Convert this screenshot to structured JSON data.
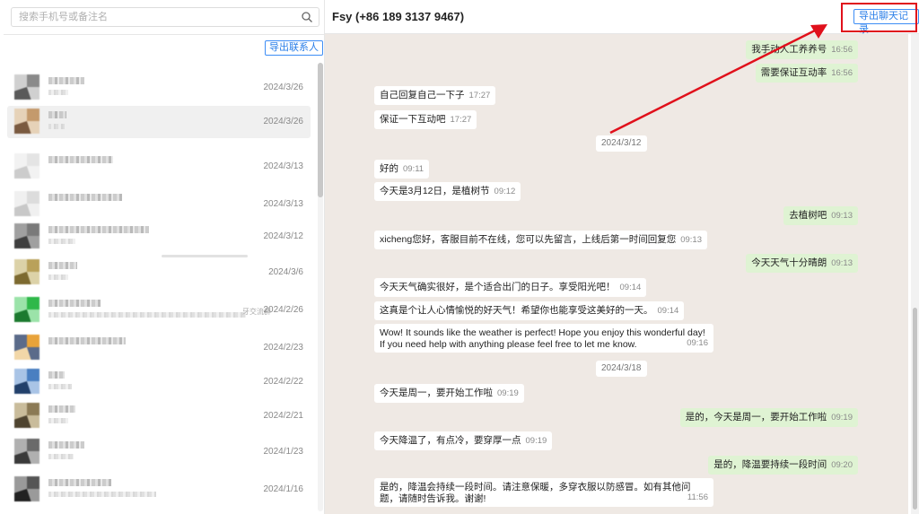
{
  "search": {
    "placeholder": "搜索手机号或备注名"
  },
  "left": {
    "export_contacts_label": "导出联系人"
  },
  "contacts": [
    {
      "date": "2024/3/26"
    },
    {
      "date": "2024/3/26"
    },
    {
      "date": "2024/3/13"
    },
    {
      "date": "2024/3/13"
    },
    {
      "date": "2024/3/12"
    },
    {
      "date": "2024/3/6"
    },
    {
      "date": "2024/2/26",
      "trail": "牙交流群"
    },
    {
      "date": "2024/2/23"
    },
    {
      "date": "2024/2/22"
    },
    {
      "date": "2024/2/21"
    },
    {
      "date": "2024/1/23"
    },
    {
      "date": "2024/1/16"
    }
  ],
  "header": {
    "title": "Fsy (+86 189 3137 9467)",
    "export_chat_label": "导出聊天记录"
  },
  "messages": [
    {
      "dir": "out",
      "text": "我手动人工养养号",
      "time": "16:56"
    },
    {
      "dir": "out",
      "text": "需要保证互动率",
      "time": "16:56"
    },
    {
      "dir": "in",
      "text": "自己回复自己一下子",
      "time": "17:27"
    },
    {
      "dir": "in",
      "text": "保证一下互动吧",
      "time": "17:27"
    },
    {
      "dir": "date",
      "text": "2024/3/12"
    },
    {
      "dir": "in",
      "text": "好的",
      "time": "09:11"
    },
    {
      "dir": "in",
      "text": "今天是3月12日，是植树节",
      "time": "09:12"
    },
    {
      "dir": "out",
      "text": "去植树吧",
      "time": "09:13"
    },
    {
      "dir": "in",
      "text": "xicheng您好，客服目前不在线，您可以先留言，上线后第一时间回复您",
      "time": "09:13"
    },
    {
      "dir": "out",
      "text": "今天天气十分晴朗",
      "time": "09:13"
    },
    {
      "dir": "in",
      "text": "今天天气确实很好，是个适合出门的日子。享受阳光吧！",
      "time": "09:14"
    },
    {
      "dir": "in",
      "text": "这真是个让人心情愉悦的好天气！希望你也能享受这美好的一天。",
      "time": "09:14"
    },
    {
      "dir": "in",
      "text": "Wow! It sounds like the weather is perfect! Hope you enjoy this wonderful day! If you need help with anything please feel free to let me know.",
      "time": "09:16"
    },
    {
      "dir": "date",
      "text": "2024/3/18"
    },
    {
      "dir": "in",
      "text": "今天是周一，要开始工作啦",
      "time": "09:19"
    },
    {
      "dir": "out",
      "text": "是的，今天是周一，要开始工作啦",
      "time": "09:19"
    },
    {
      "dir": "in",
      "text": "今天降温了，有点冷，要穿厚一点",
      "time": "09:19"
    },
    {
      "dir": "out",
      "text": "是的，降温要持续一段时间",
      "time": "09:20"
    },
    {
      "dir": "in",
      "text": "是的，降温会持续一段时间。请注意保暖，多穿衣服以防感冒。如有其他问题，请随时告诉我。谢谢!",
      "time": "11:56"
    }
  ],
  "colors": {
    "accent": "#2b7fe8",
    "annotation_red": "#e0101b",
    "chat_bg": "#efe9e4",
    "outgoing_bubble": "#dff3d3",
    "incoming_bubble": "#ffffff"
  }
}
